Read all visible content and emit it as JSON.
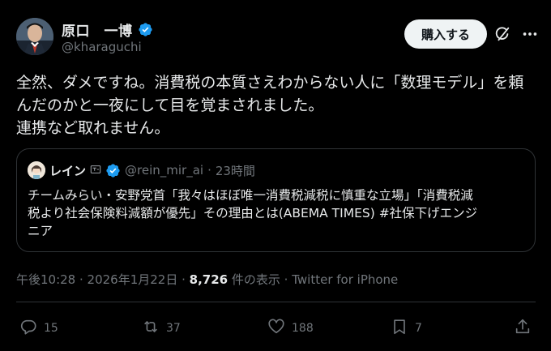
{
  "author": {
    "display_name": "原口　一博",
    "handle": "@kharaguchi",
    "verified_icon": "verified-badge-icon",
    "accent_color": "#1d9bf0"
  },
  "header": {
    "buy_label": "購入する",
    "grok_icon": "grok-icon",
    "more_icon": "more-icon"
  },
  "tweet": {
    "lines": [
      "全然、ダメですね。消費税の本質さえわからない人に「数理モデル」を頼",
      "んだのかと一夜にして目を覚まされました。",
      "連携など取れません。"
    ]
  },
  "quote": {
    "name": "レイン",
    "handle": "@rein_mir_ai",
    "separator": "·",
    "time": "23時間",
    "lines": [
      "チームみらい・安野党首「我々はほぼ唯一消費税減税に慎重な立場」「消費税減",
      "税より社会保険料減額が優先」その理由とは(ABEMA TIMES) #社保下げエンジ",
      "ニア"
    ]
  },
  "meta": {
    "time": "午後10:28",
    "sep1": " · ",
    "date": "2026年1月22日",
    "sep2": " · ",
    "views": "8,726",
    "views_label": " 件の表示",
    "sep3": " · ",
    "source": "Twitter for iPhone"
  },
  "actions": {
    "replies": "15",
    "retweets": "37",
    "likes": "188",
    "bookmarks": "7"
  }
}
